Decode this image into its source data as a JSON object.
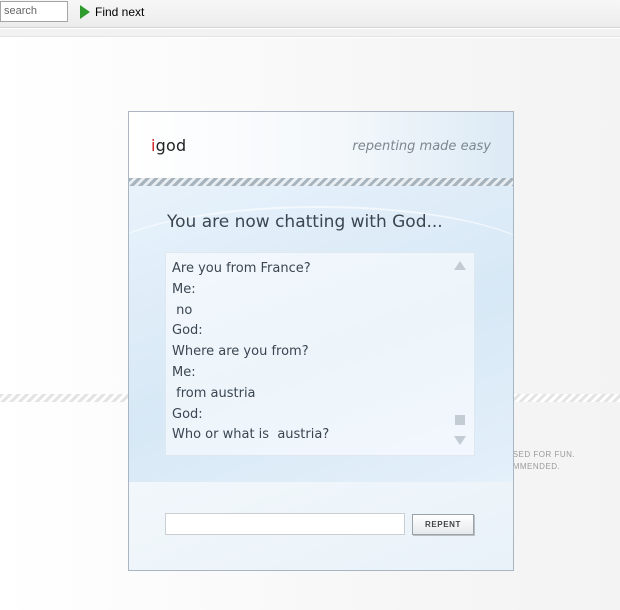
{
  "findbar": {
    "search_value": "search",
    "find_next_label": "Find next"
  },
  "background": {
    "fine_print_line1": "ISED FOR FUN.",
    "fine_print_line2": "IMMENDED."
  },
  "dialog": {
    "logo_i": "i",
    "logo_rest": "god",
    "tagline": "repenting made easy",
    "heading": "You are now chatting with God...",
    "chat_lines": [
      "Are you from France?",
      "Me:",
      " no",
      "God:",
      "Where are you from?",
      "Me:",
      " from austria",
      "God:",
      "Who or what is  austria?"
    ],
    "message_value": "",
    "repent_label": "REPENT"
  }
}
